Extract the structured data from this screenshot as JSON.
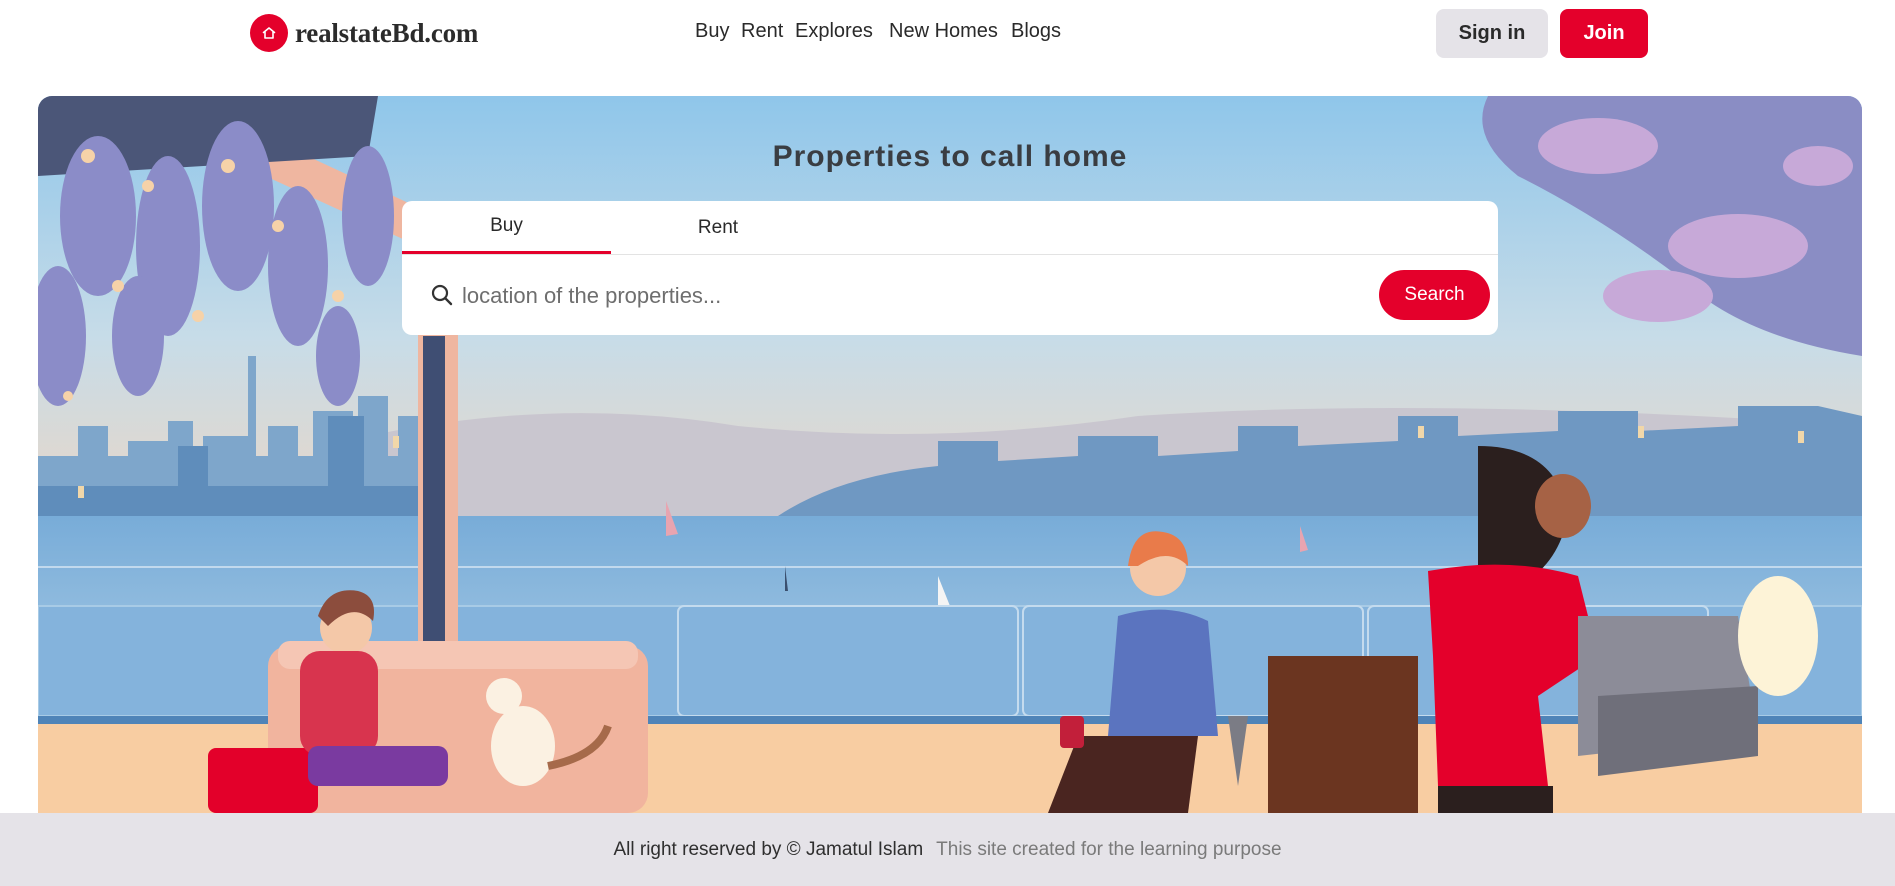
{
  "brand": {
    "name": "realstateBd.com",
    "icon": "home-icon",
    "color": "#e4002b"
  },
  "nav": {
    "links": [
      "Buy",
      "Rent",
      "Explores",
      "New Homes",
      "Blogs"
    ],
    "signin_label": "Sign in",
    "join_label": "Join"
  },
  "hero": {
    "title": "Properties to call home",
    "tabs": [
      "Buy",
      "Rent"
    ],
    "active_tab": "Buy",
    "search": {
      "placeholder": "location of the properties...",
      "value": "",
      "button_label": "Search",
      "icon": "search-icon"
    }
  },
  "footer": {
    "copyright": "All right reserved by © Jamatul Islam",
    "note": "This site created for the learning purpose"
  },
  "colors": {
    "accent": "#e4002b",
    "neutral_button": "#e5e3e8",
    "footer_bg": "#e5e3e8"
  }
}
